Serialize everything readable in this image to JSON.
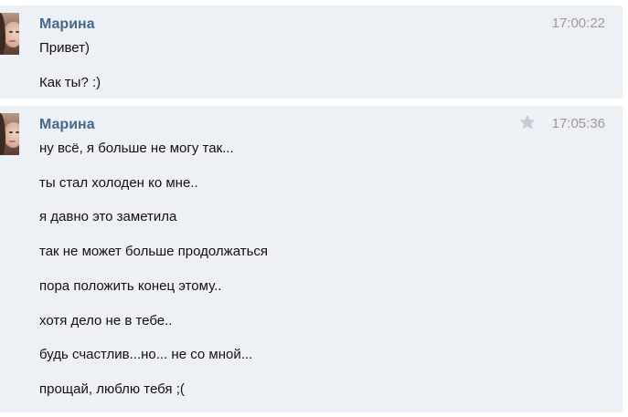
{
  "messages": [
    {
      "sender": "Марина",
      "time": "17:00:22",
      "lines": [
        "Привет)",
        "Как ты? :)"
      ]
    },
    {
      "sender": "Марина",
      "time": "17:05:36",
      "lines": [
        "ну всё, я больше не могу так...",
        "ты стал холоден ко мне..",
        "я давно это заметила",
        "так не может больше продолжаться",
        "пора положить конец этому..",
        "хотя дело не в тебе..",
        "будь счастлив...но... не со мной...",
        "прощай, люблю тебя ;("
      ]
    }
  ],
  "icons": {
    "star": "star-icon",
    "avatar": "avatar-photo"
  },
  "colors": {
    "block_bg": "#edf1f5",
    "sender": "#45688e",
    "time": "#999999",
    "text": "#111111",
    "star": "#c5ccd4"
  }
}
